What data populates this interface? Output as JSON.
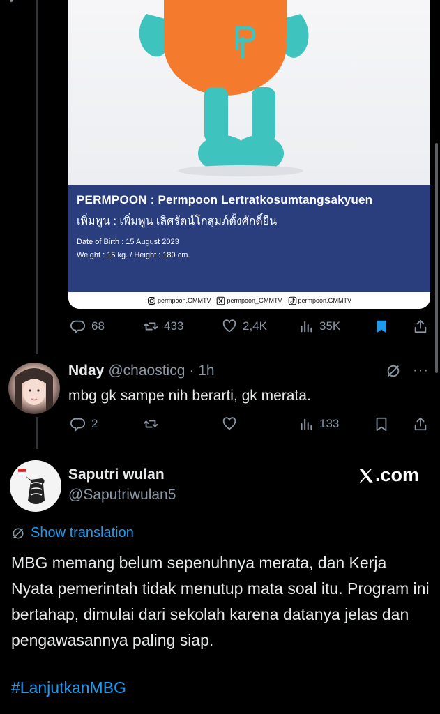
{
  "card": {
    "title": "PERMPOON : Permpoon Lertratkosumtangsakyuen",
    "thai_name": "เพิ่มพูน : เพิ่มพูน  เลิศรัตน์โกสุมภ์ตั้งศักดิ์ยืน",
    "dob": "Date of  Birth : 15 August 2023",
    "weight_height": "Weight : 15 kg. / Height : 180 cm.",
    "social": [
      "permpoon.GMMTV",
      "permpoon_GMMTV",
      "permpoon.GMMTV"
    ]
  },
  "tweet1_actions": {
    "replies": "68",
    "reposts": "433",
    "likes": "2,4K",
    "views": "35K"
  },
  "reply": {
    "name": "Nday",
    "handle": "@chaosticg",
    "time": "· 1h",
    "text": "mbg gk sampe nih berarti, gk merata.",
    "replies": "2",
    "views": "133"
  },
  "quote": {
    "name": "Saputri wulan",
    "handle": "@Saputriwulan5",
    "brand": ".com",
    "show_translation": "Show translation",
    "body": "MBG memang belum sepenuhnya merata, dan Kerja Nyata pemerintah tidak menutup mata soal itu. Program ini bertahap, dimulai dari sekolah karena datanya jelas dan pengawasannya paling siap.",
    "hashtag": "#LanjutkanMBG"
  },
  "colors": {
    "accent": "#1d9bf0",
    "muted": "#8b98a5",
    "band": "#2a3d7c",
    "mascot_orange": "#f47a2e",
    "mascot_teal": "#3fc3bf"
  }
}
